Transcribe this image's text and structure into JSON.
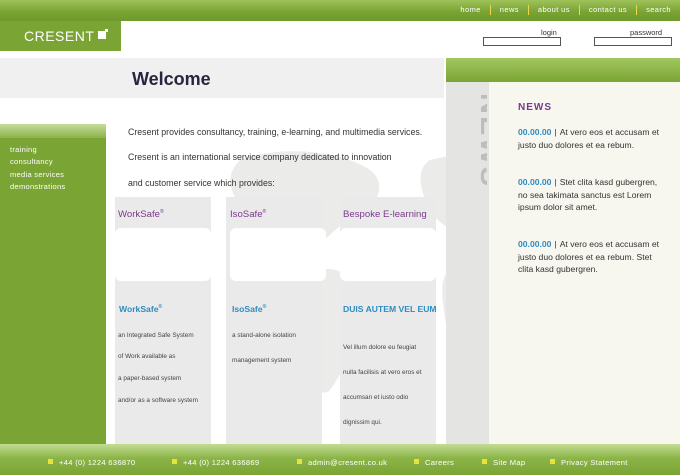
{
  "topnav": [
    "home",
    "news",
    "about us",
    "contact us",
    "search"
  ],
  "logo": {
    "text": "CRESENT"
  },
  "login": {
    "login_label": "login",
    "password_label": "password",
    "login_value": "",
    "password_value": ""
  },
  "welcome": {
    "title": "Welcome"
  },
  "sidebar": {
    "items": [
      "training",
      "consultancy",
      "media services",
      "demonstrations"
    ]
  },
  "intro": {
    "line1": "Cresent provides consultancy, training, e-learning, and multimedia services.",
    "line2": "Cresent is an international service company dedicated to innovation",
    "line3": "and customer service which provides:"
  },
  "columns": [
    {
      "heading": "WorkSafe",
      "heading_sup": "®",
      "subheading": "WorkSafe",
      "subheading_sup": "®",
      "lines": [
        "an Integrated Safe System",
        "of Work available as",
        "a paper-based system",
        "and/or as a software system"
      ]
    },
    {
      "heading": "IsoSafe",
      "heading_sup": "®",
      "subheading": "IsoSafe",
      "subheading_sup": "®",
      "lines": [
        "a stand-alone isolation",
        "management system"
      ]
    },
    {
      "heading": "Bespoke E-learning",
      "heading_sup": "",
      "subheading": "DUIS AUTEM VEL EUM",
      "subheading_sup": "",
      "lines": [
        "Vel illum dolore eu feugiat",
        "nulla facilisis at vero eros et",
        "accumsan et iusto odio",
        "dignissim qui."
      ]
    }
  ],
  "news": {
    "vertical_label": "NEWS",
    "heading": "NEWS",
    "items": [
      {
        "date": "00.00.00",
        "sep": "|",
        "text": "At vero eos et accusam et justo duo dolores et ea rebum."
      },
      {
        "date": "00.00.00",
        "sep": "|",
        "text": "Stet clita kasd gubergren, no sea takimata sanctus est Lorem ipsum dolor sit amet."
      },
      {
        "date": "00.00.00",
        "sep": "|",
        "text": "At vero eos et accusam et justo duo dolores et ea rebum. Stet clita kasd gubergren."
      }
    ]
  },
  "footer": {
    "phone1": "+44 (0) 1224 636870",
    "phone2": "+44 (0) 1224 636869",
    "email": "admin@cresent.co.uk",
    "links": [
      "Careers",
      "Site Map",
      "Privacy Statement"
    ]
  },
  "colors": {
    "brand_green": "#7aa434",
    "accent_purple": "#7a3a8c",
    "accent_blue": "#2e8cc0",
    "bullet_yellow": "#e8e23a"
  }
}
